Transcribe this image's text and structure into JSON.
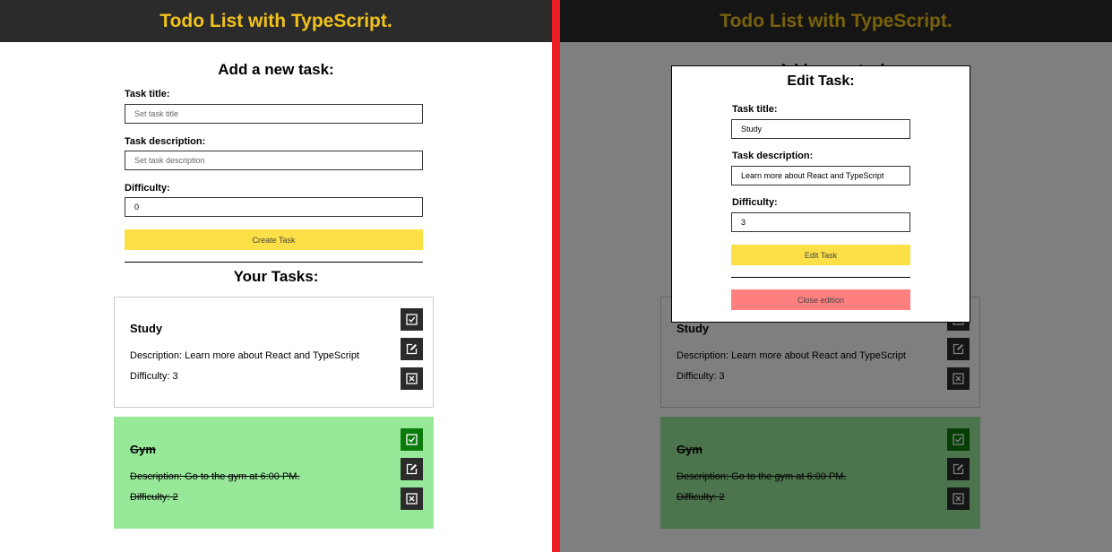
{
  "app": {
    "title": "Todo List with TypeScript."
  },
  "create_form": {
    "heading": "Add a new task:",
    "title_label": "Task title:",
    "title_placeholder": "Set task title",
    "description_label": "Task description:",
    "description_placeholder": "Set task description",
    "difficulty_label": "Difficulty:",
    "difficulty_value": "0",
    "submit_label": "Create Task"
  },
  "tasks_heading": "Your Tasks:",
  "tasks": [
    {
      "title": "Study",
      "description": "Description: Learn more about React and TypeScript",
      "difficulty": "Difficulty: 3",
      "done": false
    },
    {
      "title": "Gym",
      "description": "Description: Go to the gym at 6:00 PM.",
      "difficulty": "Difficulty: 2",
      "done": true
    }
  ],
  "edit_modal": {
    "heading": "Edit Task:",
    "title_label": "Task title:",
    "title_value": "Study",
    "description_label": "Task description:",
    "description_value": "Learn more about React and TypeScript",
    "difficulty_label": "Difficulty:",
    "difficulty_value": "3",
    "submit_label": "Edit Task",
    "close_label": "Close edition"
  },
  "colors": {
    "header_bg": "#2b2b2b",
    "title_text": "#f1c21b",
    "primary_button": "#fddf47",
    "done_card": "#98e89a",
    "done_check": "#0a7a0a",
    "close_button": "#ff7f7f",
    "divider": "#ee1c25"
  },
  "icons": {
    "complete": "checkbox-icon",
    "edit": "edit-icon",
    "delete": "delete-icon"
  }
}
